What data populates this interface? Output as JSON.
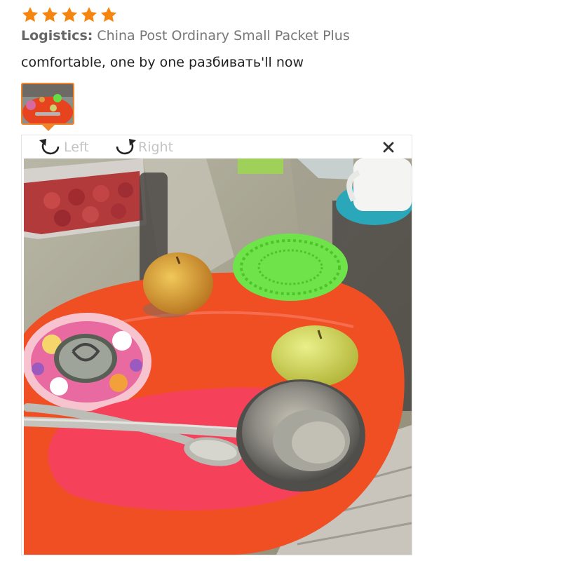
{
  "review": {
    "rating": 5,
    "rating_max": 5,
    "star_color": "#f5850f",
    "logistics_label": "Logistics:",
    "logistics_value": "China Post Ordinary Small Packet Plus",
    "comment": "comfortable, one by one разбивать'll now"
  },
  "viewer": {
    "rotate_left_label": "Left",
    "rotate_right_label": "Right",
    "accent": "#f0852c",
    "icons": {
      "rotate_left": "rotate-left-icon",
      "rotate_right": "rotate-right-icon",
      "close": "close-icon"
    }
  }
}
